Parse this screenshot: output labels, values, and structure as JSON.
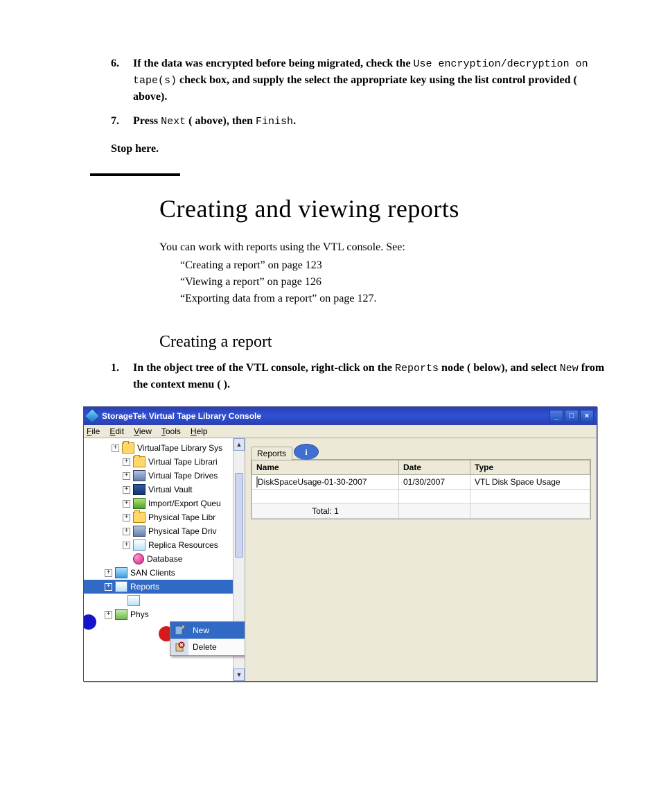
{
  "steps_top": [
    {
      "num": "6.",
      "parts": [
        {
          "t": "bold",
          "v": "If the data was encrypted before being migrated, check the "
        },
        {
          "t": "mono",
          "v": "Use encryption/decryption on tape(s)"
        },
        {
          "t": "bold",
          "v": " check box, and supply the select the appropriate key using the list control provided (   above)."
        }
      ]
    },
    {
      "num": "7.",
      "parts": [
        {
          "t": "bold",
          "v": "Press "
        },
        {
          "t": "mono",
          "v": "Next"
        },
        {
          "t": "bold",
          "v": " (   above), then  "
        },
        {
          "t": "mono",
          "v": "Finish"
        },
        {
          "t": "bold",
          "v": "."
        }
      ]
    }
  ],
  "stop_text": "Stop here.",
  "section_title": "Creating and viewing reports",
  "intro": "You can work with reports using the VTL console. See:",
  "toc": [
    "“Creating a report” on page 123",
    "“Viewing a report” on page 126",
    "“Exporting data from a report” on page 127."
  ],
  "subheading": "Creating a report",
  "step1": {
    "num": "1.",
    "parts": [
      {
        "t": "bold",
        "v": "In the object tree of the VTL console, right-click on the "
      },
      {
        "t": "mono",
        "v": "Reports"
      },
      {
        "t": "bold",
        "v": " node (   below), and select "
      },
      {
        "t": "mono",
        "v": "New"
      },
      {
        "t": "bold",
        "v": " from the context menu (   )."
      }
    ]
  },
  "app": {
    "title": "StorageTek Virtual Tape Library Console",
    "menus": [
      "File",
      "Edit",
      "View",
      "Tools",
      "Help"
    ],
    "tree": [
      {
        "indent": "indent0",
        "icon": "folder",
        "plus": "□",
        "label": "VirtualTape Library Sys"
      },
      {
        "indent": "indent1",
        "icon": "folder",
        "plus": "✧",
        "label": "Virtual Tape Librari"
      },
      {
        "indent": "indent1",
        "icon": "drive",
        "plus": "✧",
        "label": "Virtual Tape Drives"
      },
      {
        "indent": "indent1",
        "icon": "vault",
        "plus": "✧",
        "label": "Virtual Vault"
      },
      {
        "indent": "indent1",
        "icon": "q",
        "plus": "✧",
        "label": "Import/Export Queu"
      },
      {
        "indent": "indent1",
        "icon": "folder",
        "plus": "✧",
        "label": "Physical Tape Libr"
      },
      {
        "indent": "indent1",
        "icon": "drive",
        "plus": "✧",
        "label": "Physical Tape Driv"
      },
      {
        "indent": "indent1",
        "icon": "rep",
        "plus": "✧",
        "label": "Replica Resources"
      },
      {
        "indent": "indent1",
        "icon": "db",
        "plus": "",
        "label": "Database"
      },
      {
        "indent": "indentA",
        "icon": "san",
        "plus": "✧",
        "label": "SAN Clients"
      },
      {
        "indent": "indentA",
        "icon": "rep",
        "plus": "□",
        "label": "Reports",
        "sel": true
      },
      {
        "indent": "indentR",
        "icon": "rep",
        "plus": "",
        "label": ""
      },
      {
        "indent": "indentA",
        "icon": "phys",
        "plus": "✧",
        "label": "Phys"
      }
    ],
    "ctx": [
      {
        "label": "New",
        "icon": "new",
        "sel": true
      },
      {
        "label": "Delete",
        "icon": "del",
        "sel": false
      }
    ],
    "tab_label": "Reports",
    "grid": {
      "headers": [
        "Name",
        "Date",
        "Type"
      ],
      "row": {
        "name": "DiskSpaceUsage-01-30-2007",
        "date": "01/30/2007",
        "type": "VTL Disk Space Usage"
      },
      "total": "Total:  1"
    }
  }
}
